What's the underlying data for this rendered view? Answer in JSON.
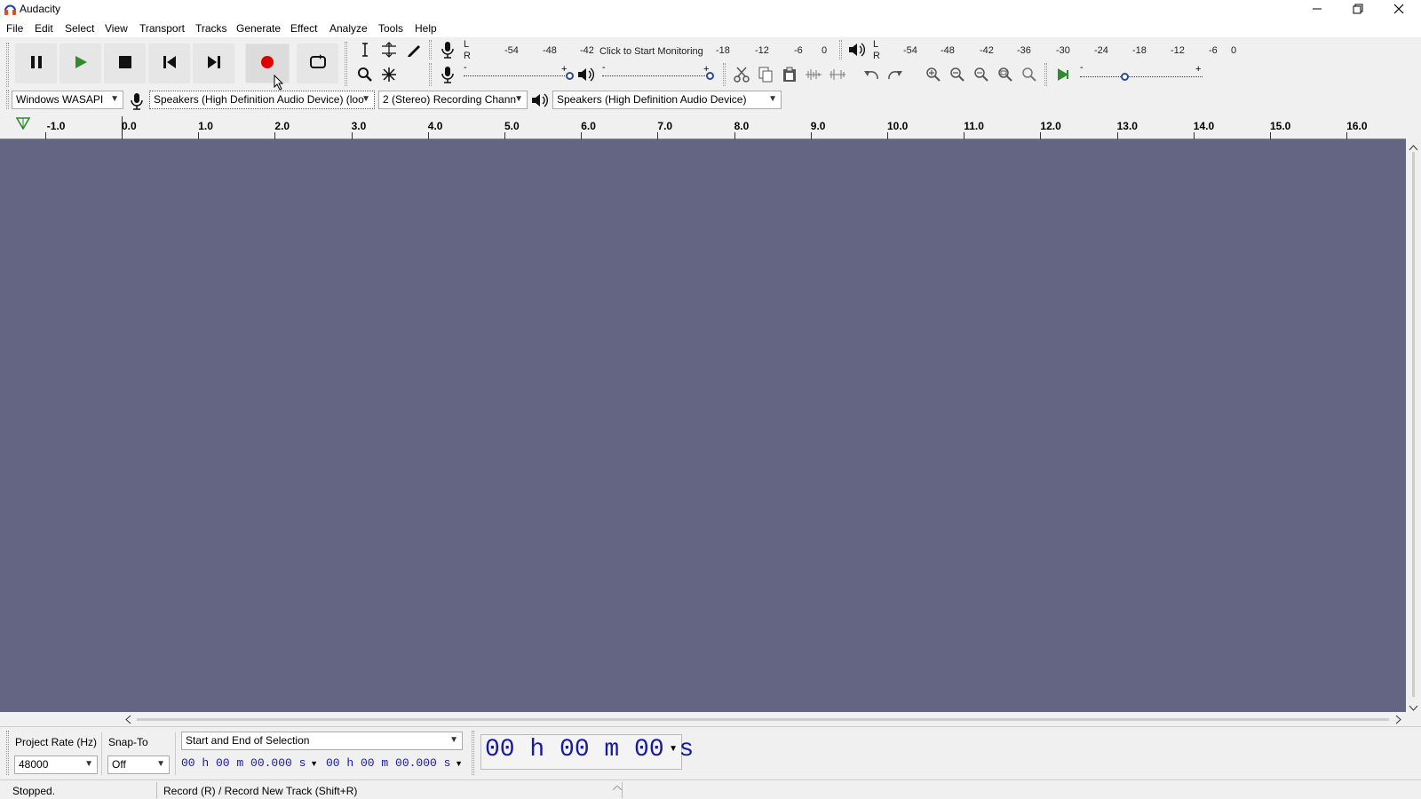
{
  "app": {
    "title": "Audacity"
  },
  "menu": [
    "File",
    "Edit",
    "Select",
    "View",
    "Transport",
    "Tracks",
    "Generate",
    "Effect",
    "Analyze",
    "Tools",
    "Help"
  ],
  "record_meter": {
    "channels": [
      "L",
      "R"
    ],
    "ticks": [
      "-54",
      "-48",
      "-42",
      "-18",
      "-12",
      "-6",
      "0"
    ],
    "prompt": "Click to Start Monitoring"
  },
  "play_meter": {
    "channels": [
      "L",
      "R"
    ],
    "ticks": [
      "-54",
      "-48",
      "-42",
      "-36",
      "-30",
      "-24",
      "-18",
      "-12",
      "-6",
      "0"
    ]
  },
  "slider_minus": "-",
  "slider_plus": "+",
  "device": {
    "host": "Windows WASAPI",
    "recording_device": "Speakers (High Definition Audio Device) (loo",
    "channels": "2 (Stereo) Recording Chann",
    "playback_device": "Speakers (High Definition Audio Device)"
  },
  "ruler": {
    "ticks": [
      "-1.0",
      "0.0",
      "1.0",
      "2.0",
      "3.0",
      "4.0",
      "5.0",
      "6.0",
      "7.0",
      "8.0",
      "9.0",
      "10.0",
      "11.0",
      "12.0",
      "13.0",
      "14.0",
      "15.0",
      "16.0"
    ]
  },
  "selection": {
    "project_rate_label": "Project Rate (Hz)",
    "project_rate_value": "48000",
    "snap_to_label": "Snap-To",
    "snap_to_value": "Off",
    "selection_mode": "Start and End of Selection",
    "start_time": "00 h 00 m 00.000 s",
    "end_time": "00 h 00 m 00.000 s",
    "audio_position": "00 h 00 m 00 s"
  },
  "status": {
    "state": "Stopped.",
    "hint": "Record (R) / Record New Track (Shift+R)"
  },
  "colors": {
    "track_bg": "#646483",
    "record_red": "#dd0000",
    "play_green": "#2e8b2e",
    "time_blue": "#1a1aa0"
  }
}
